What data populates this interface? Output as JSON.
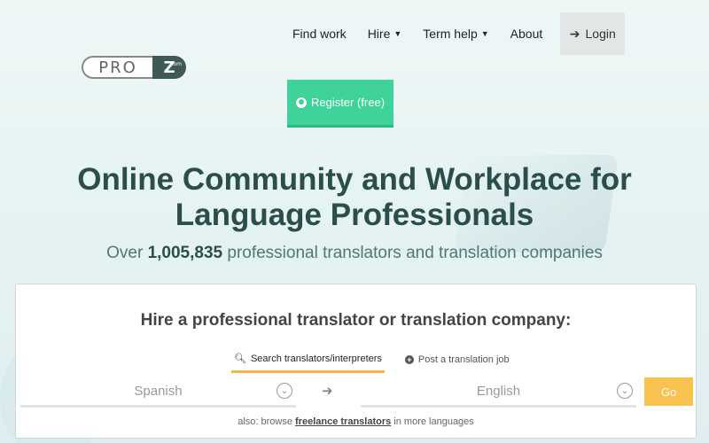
{
  "logo": {
    "pro": "PRO",
    "z": "Z",
    "dotcom": ".com"
  },
  "nav": {
    "items": [
      {
        "label": "Find work",
        "caret": false
      },
      {
        "label": "Hire",
        "caret": true
      },
      {
        "label": "Term help",
        "caret": true
      },
      {
        "label": "About",
        "caret": false
      }
    ],
    "login_label": "Login",
    "register_label": "Register (free)"
  },
  "hero": {
    "title_line1": "Online Community and Workplace for",
    "title_line2": "Language Professionals",
    "sub_prefix": "Over ",
    "sub_count": "1,005,835",
    "sub_suffix": " professional translators and translation companies"
  },
  "search": {
    "title": "Hire a professional translator or translation company:",
    "tab_search": "Search translators/interpreters",
    "tab_post": "Post a translation job",
    "source_lang": "Spanish",
    "target_lang": "English",
    "go_label": "Go",
    "also_prefix": "also: browse ",
    "also_link": "freelance translators",
    "also_suffix": " in more languages"
  },
  "colors": {
    "brand": "#2b4e4b",
    "register": "#3fd39a",
    "go": "#f8c34f",
    "tab_active": "#f5b942"
  }
}
